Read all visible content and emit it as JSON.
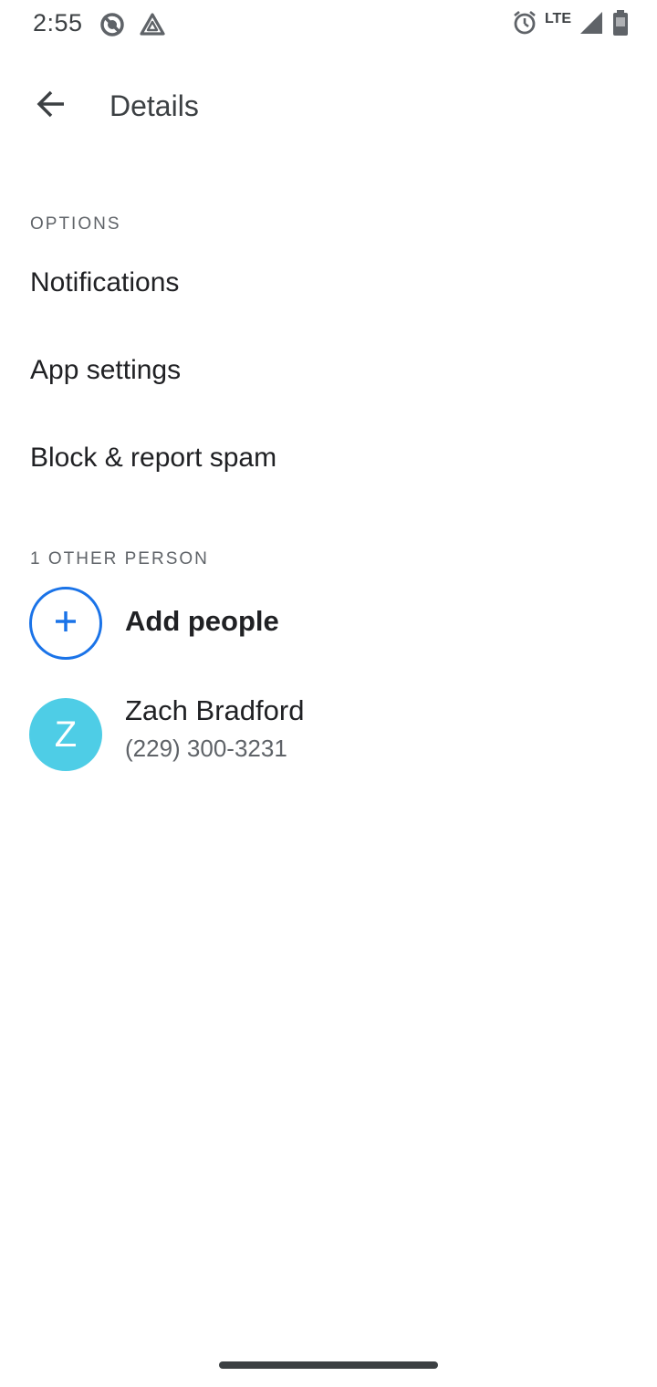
{
  "status_bar": {
    "time": "2:55",
    "network": "LTE",
    "left_icons": [
      "do-not-disturb-icon",
      "drive-icon"
    ],
    "right_icons": [
      "alarm-icon",
      "signal-icon",
      "battery-icon"
    ]
  },
  "app_bar": {
    "back_icon": "arrow-back-icon",
    "title": "Details"
  },
  "options": {
    "header": "OPTIONS",
    "items": [
      {
        "label": "Notifications"
      },
      {
        "label": "App settings"
      },
      {
        "label": "Block & report spam"
      }
    ]
  },
  "people": {
    "header": "1 OTHER PERSON",
    "add_label": "Add people",
    "contacts": [
      {
        "initial": "Z",
        "name": "Zach Bradford",
        "phone": "(229) 300-3231",
        "avatar_color": "#4ecde6"
      }
    ]
  },
  "colors": {
    "accent": "#1a73e8",
    "text_primary": "#202124",
    "text_secondary": "#5f6368"
  }
}
